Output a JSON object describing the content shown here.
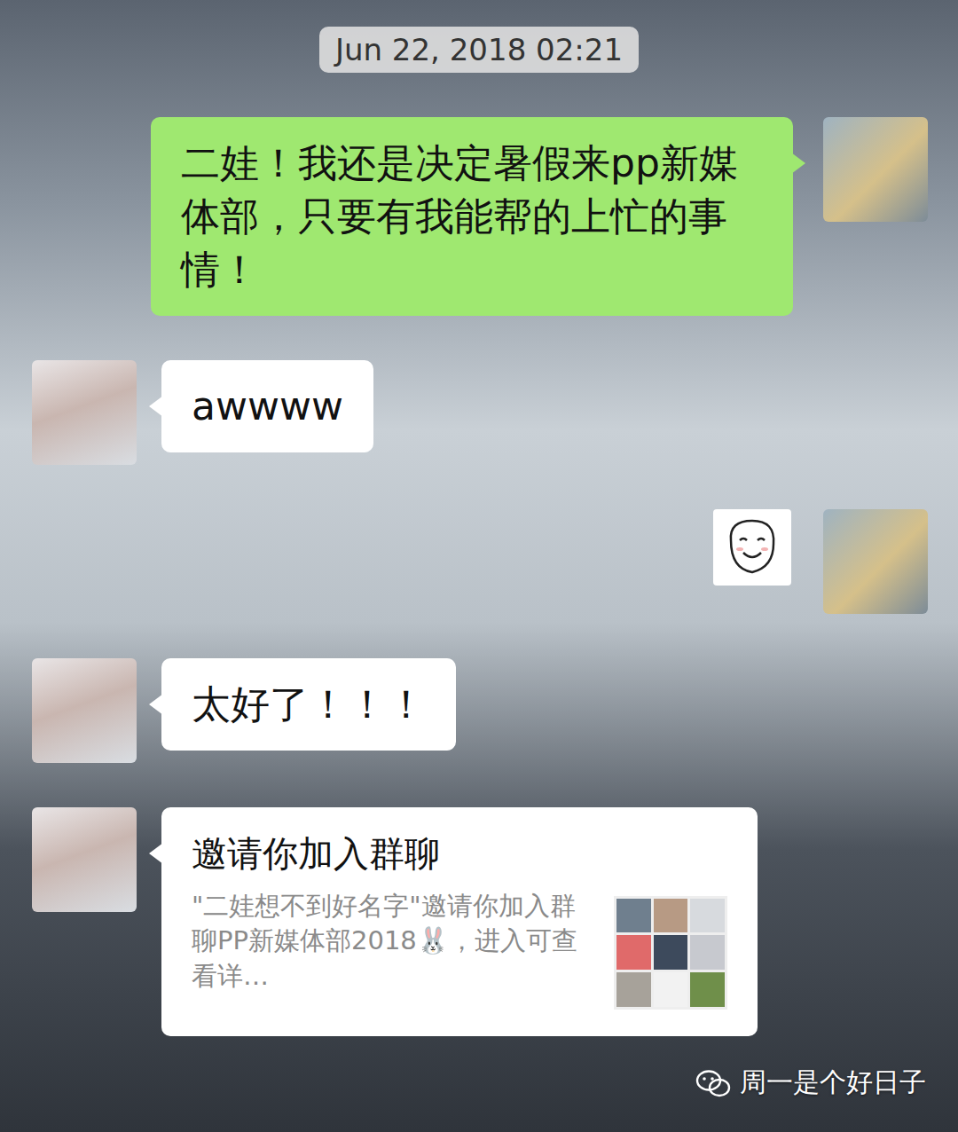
{
  "timestamp": "Jun 22, 2018 02:21",
  "messages": [
    {
      "kind": "text",
      "side": "right",
      "text": "二娃！我还是决定暑假来pp新媒体部，只要有我能帮的上忙的事情！"
    },
    {
      "kind": "text",
      "side": "left",
      "text": "awwww"
    },
    {
      "kind": "sticker",
      "side": "right"
    },
    {
      "kind": "text",
      "side": "left",
      "text": "太好了！！！"
    },
    {
      "kind": "invite",
      "side": "left",
      "title": "邀请你加入群聊",
      "description": "\"二娃想不到好名字\"邀请你加入群聊PP新媒体部2018🐰，进入可查看详…"
    }
  ],
  "watermark": {
    "text": "周一是个好日子"
  }
}
